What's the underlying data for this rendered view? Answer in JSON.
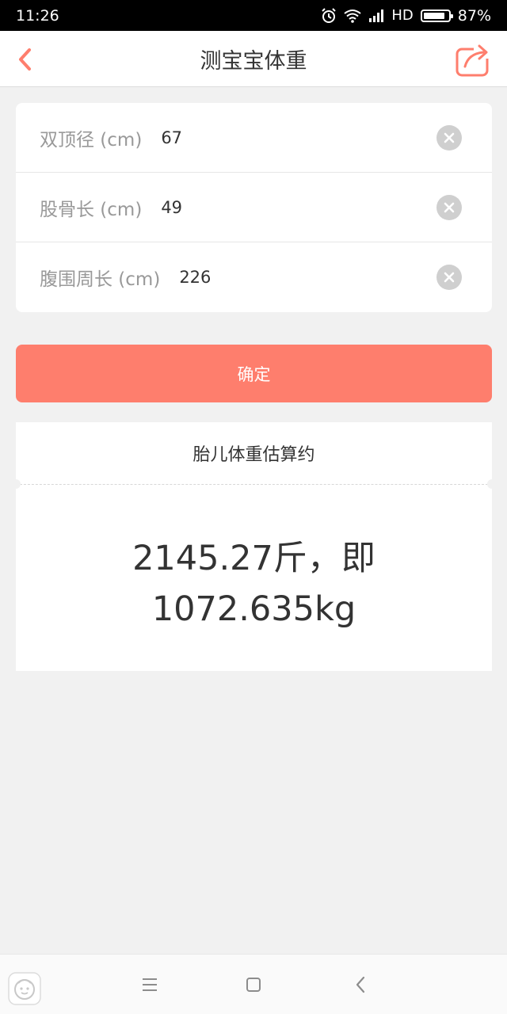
{
  "status_bar": {
    "time": "11:26",
    "network": "HD",
    "battery": "87%",
    "battery_level": 0.87
  },
  "nav": {
    "title": "测宝宝体重",
    "back_icon": "chevron-left-icon",
    "share_icon": "share-icon"
  },
  "form": {
    "rows": [
      {
        "label": "双顶径 (cm)",
        "value": "67"
      },
      {
        "label": "股骨长 (cm)",
        "value": "49"
      },
      {
        "label": "腹围周长 (cm)",
        "value": "226"
      }
    ]
  },
  "confirm_label": "确定",
  "result": {
    "header": "胎儿体重估算约",
    "line1": "2145.27斤，即",
    "line2": "1072.635kg"
  },
  "colors": {
    "accent": "#fe7e6d",
    "background": "#f1f1f1"
  }
}
